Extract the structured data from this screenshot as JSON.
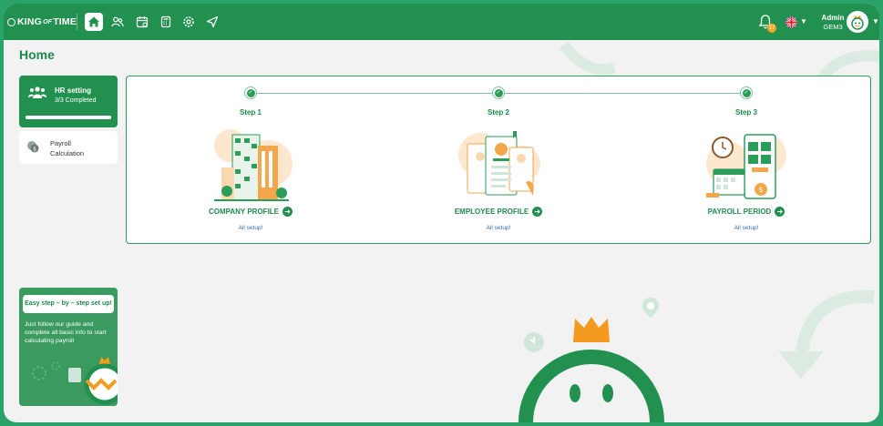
{
  "app": {
    "logo_text_1": "KING",
    "logo_text_of": "OF",
    "logo_text_2": "TIME"
  },
  "header": {
    "nav_icons": [
      "home-icon",
      "users-icon",
      "calendar-icon",
      "calculator-icon",
      "gear-icon",
      "send-icon"
    ],
    "notification_count": "17",
    "user_name": "Admin",
    "user_org": "GEM3"
  },
  "page": {
    "title": "Home"
  },
  "sidebar": {
    "hr_setting": {
      "label": "HR setting",
      "progress_text": "3/3 Completed",
      "progress": 1.0
    },
    "payroll": {
      "label": "Payroll Calculation"
    }
  },
  "steps": [
    {
      "label": "Step 1",
      "name": "COMPANY PROFILE",
      "status": "All setup!"
    },
    {
      "label": "Step 2",
      "name": "EMPLOYEE PROFILE",
      "status": "All setup!"
    },
    {
      "label": "Step 3",
      "name": "PAYROLL PERIOD",
      "status": "All setup!"
    }
  ],
  "promo": {
    "heading": "Easy step – by – step set up!",
    "body": "Just follow our guide and complete all basic info to start calculating payroll"
  },
  "colors": {
    "brand_green": "#22904f",
    "accent_orange": "#f5a623",
    "link_blue": "#2b6fb5"
  }
}
